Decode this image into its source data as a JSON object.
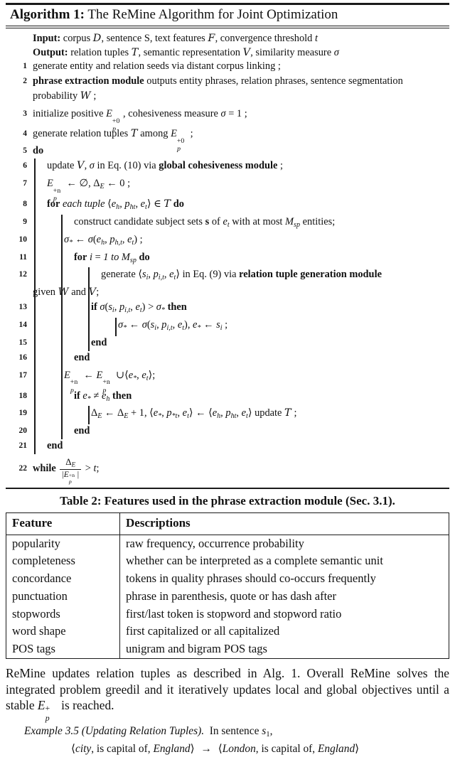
{
  "algorithm": {
    "title_bold": "Algorithm 1:",
    "title_rest": " The ReMine Algorithm for Joint Optimization",
    "input_label": "Input:",
    "input_text": " corpus D, sentence S, text features F, convergence threshold t",
    "output_label": "Output:",
    "output_text": " relation tuples T, semantic representation V, similarity measure σ",
    "lines": [
      {
        "n": "1",
        "text": "generate entity and relation seeds via distant corpus linking ;"
      },
      {
        "n": "2",
        "text": "phrase extraction module outputs entity phrases, relation phrases, sentence segmentation"
      },
      {
        "n": "",
        "text": "probability W ;"
      },
      {
        "n": "3",
        "text": "initialize positive E_p^{+0}, cohesiveness measure σ = 1 ;"
      },
      {
        "n": "4",
        "text": "generate relation tuples T among E_p^{+0} ;"
      },
      {
        "n": "5",
        "text": "do"
      },
      {
        "n": "6",
        "text": "update V, σ in Eq. (10) via global cohesiveness module ;"
      },
      {
        "n": "7",
        "text": "E_p^{+n} ← ∅, Δ_E ← 0 ;"
      },
      {
        "n": "8",
        "text": "for each tuple ⟨e_h, p_ht, e_t⟩ ∈ T do"
      },
      {
        "n": "9",
        "text": "construct candidate subject sets s of e_t with at most M_sp entities;"
      },
      {
        "n": "10",
        "text": "σ_* ← σ(e_h, p_h,t, e_t) ;"
      },
      {
        "n": "11",
        "text": "for i = 1 to M_sp do"
      },
      {
        "n": "12",
        "text": "generate ⟨s_i, p_i,t, e_t⟩ in Eq. (9) via relation tuple generation module"
      },
      {
        "n": "",
        "text": "given W and V;"
      },
      {
        "n": "13",
        "text": "if σ(s_i, p_i,t, e_t) > σ_* then"
      },
      {
        "n": "14",
        "text": "σ_* ← σ(s_i, p_i,t, e_t), e_* ← s_i ;"
      },
      {
        "n": "15",
        "text": "end"
      },
      {
        "n": "16",
        "text": "end"
      },
      {
        "n": "17",
        "text": "E_p^{+n} ← E_p^{+n} ∪ ⟨e_*, e_t⟩;"
      },
      {
        "n": "18",
        "text": "if e_* ≠ e_h then"
      },
      {
        "n": "19",
        "text": "Δ_E ← Δ_E + 1, ⟨e_*, p_*t, e_t⟩ ← ⟨e_h, p_ht, e_t⟩ update T ;"
      },
      {
        "n": "20",
        "text": "end"
      },
      {
        "n": "21",
        "text": "end"
      },
      {
        "n": "22",
        "text": "while Δ_E / |E_p^{+n}| > t;"
      }
    ],
    "keywords": {
      "do": "do",
      "while": "while",
      "for": "for",
      "each_tuple": "each tuple",
      "if": "if",
      "then": "then",
      "end": "end",
      "in": "in",
      "to": "to",
      "generate": "generate",
      "update": "update",
      "initialize_positive": "initialize positive",
      "cohesiveness_measure": "cohesiveness measure",
      "generate_relation_tuples": "generate relation tuples",
      "among": "among",
      "construct": "construct candidate subject sets",
      "of": "of",
      "with_at_most": "with at most",
      "entities": "entities;",
      "via": "via",
      "given": "given",
      "and": "and",
      "update_t": "update",
      "eq10": "Eq. (10)",
      "eq9": "Eq. (9)",
      "mod_global": "global cohesiveness module",
      "mod_phrase": "phrase extraction module",
      "mod_reltuple": "relation tuple generation module",
      "phrase_out": "outputs entity phrases, relation phrases, sentence segmentation",
      "probability": "probability",
      "line1": "generate entity and relation seeds via distant corpus linking ;"
    }
  },
  "table2": {
    "caption": "Table 2: Features used in the phrase extraction module (Sec. 3.1).",
    "headers": [
      "Feature",
      "Descriptions"
    ],
    "rows": [
      [
        "popularity",
        "raw frequency, occurrence probability"
      ],
      [
        "completeness",
        "whether can be interpreted as a complete semantic unit"
      ],
      [
        "concordance",
        "tokens in quality phrases should co-occurs frequently"
      ],
      [
        "punctuation",
        "phrase in parenthesis, quote or has dash after"
      ],
      [
        "stopwords",
        "first/last token is stopword and stopword ratio"
      ],
      [
        "word shape",
        "first capitalized or all capitalized"
      ],
      [
        "POS tags",
        "unigram and bigram POS tags"
      ]
    ]
  },
  "paragraph": {
    "part1": "ReMine updates relation tuples as described in Alg. 1. Overall ReMine solves the integrated problem greedil and it iteratively updates local and global objectives until a stable ",
    "part2": " is reached."
  },
  "example": {
    "label": "Example 3.5 (Updating Relation Tuples).",
    "text": "In sentence",
    "sentence_var": "s",
    "sentence_idx": "1",
    "comma": ",",
    "tuple_left": "⟨city, is capital of, England⟩",
    "arrow": "→",
    "tuple_right": "⟨London, is capital of, England⟩"
  },
  "symbols": {
    "D": "D",
    "F": "F",
    "T": "T",
    "V": "V",
    "W": "W",
    "sigma": "σ",
    "emptyset": "∅",
    "delta": "Δ",
    "in": "∈",
    "arrow_left": "←",
    "union": "∪",
    "gt": ">",
    "neq": "≠",
    "langle": "⟨",
    "rangle": "⟩"
  },
  "colors": {
    "ink": "#111111",
    "rule": "#1a1a1a",
    "background": "#ffffff"
  }
}
